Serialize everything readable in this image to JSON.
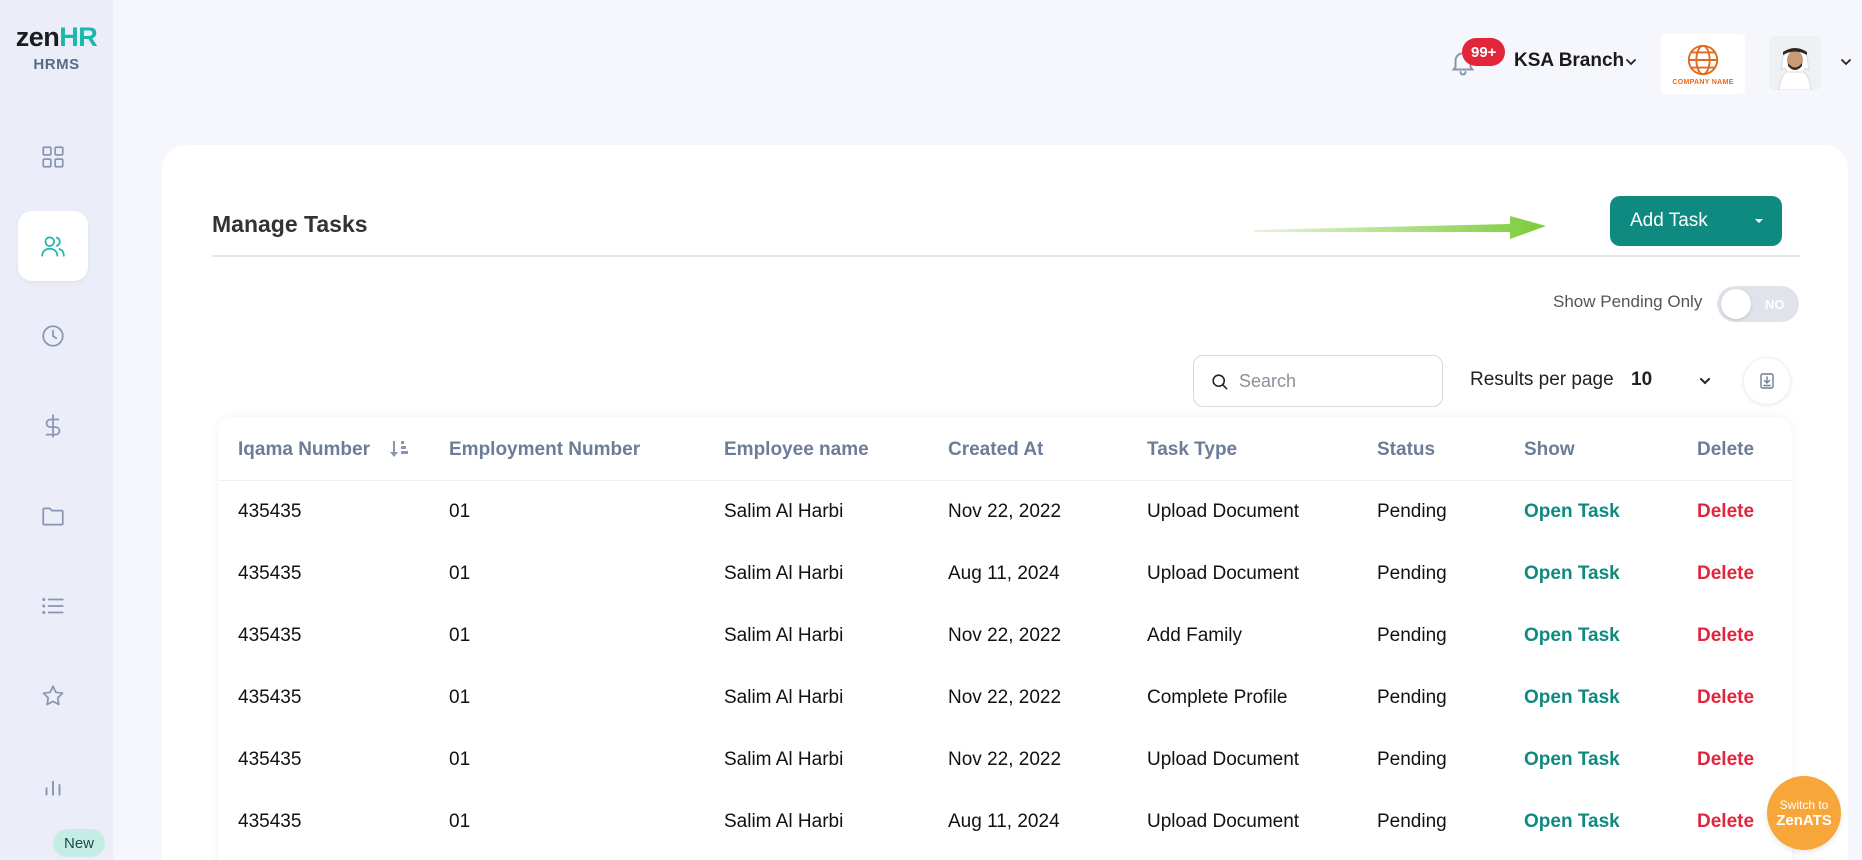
{
  "app": {
    "logo_main": "zen",
    "logo_accent": "HR",
    "logo_sub": "HRMS"
  },
  "sidebar": {
    "items": [
      {
        "name": "dashboard",
        "icon": "grid-icon"
      },
      {
        "name": "employees",
        "icon": "users-icon",
        "active": true
      },
      {
        "name": "attendance",
        "icon": "clock-icon"
      },
      {
        "name": "payroll",
        "icon": "dollar-icon"
      },
      {
        "name": "documents",
        "icon": "folder-icon"
      },
      {
        "name": "lists",
        "icon": "list-icon"
      },
      {
        "name": "performance",
        "icon": "star-icon"
      },
      {
        "name": "reports",
        "icon": "bar-chart-icon"
      }
    ],
    "new_badge": "New"
  },
  "header": {
    "notifications_count": "99+",
    "branch": "KSA Branch",
    "company_name": "COMPANY NAME"
  },
  "page": {
    "title": "Manage Tasks",
    "add_task_label": "Add Task",
    "show_pending_label": "Show Pending Only",
    "show_pending_state": "NO",
    "search_placeholder": "Search",
    "results_per_page_label": "Results per page",
    "results_per_page_value": "10"
  },
  "table": {
    "columns": [
      "Iqama Number",
      "Employment Number",
      "Employee name",
      "Created At",
      "Task Type",
      "Status",
      "Show",
      "Delete"
    ],
    "rows": [
      {
        "iqama": "435435",
        "employment": "01",
        "name": "Salim Al Harbi",
        "created": "Nov 22, 2022",
        "type": "Upload Document",
        "status": "Pending",
        "show": "Open Task",
        "delete": "Delete"
      },
      {
        "iqama": "435435",
        "employment": "01",
        "name": "Salim Al Harbi",
        "created": "Aug 11, 2024",
        "type": "Upload Document",
        "status": "Pending",
        "show": "Open Task",
        "delete": "Delete"
      },
      {
        "iqama": "435435",
        "employment": "01",
        "name": "Salim Al Harbi",
        "created": "Nov 22, 2022",
        "type": "Add Family",
        "status": "Pending",
        "show": "Open Task",
        "delete": "Delete"
      },
      {
        "iqama": "435435",
        "employment": "01",
        "name": "Salim Al Harbi",
        "created": "Nov 22, 2022",
        "type": "Complete Profile",
        "status": "Pending",
        "show": "Open Task",
        "delete": "Delete"
      },
      {
        "iqama": "435435",
        "employment": "01",
        "name": "Salim Al Harbi",
        "created": "Nov 22, 2022",
        "type": "Upload Document",
        "status": "Pending",
        "show": "Open Task",
        "delete": "Delete"
      },
      {
        "iqama": "435435",
        "employment": "01",
        "name": "Salim Al Harbi",
        "created": "Aug 11, 2024",
        "type": "Upload Document",
        "status": "Pending",
        "show": "Open Task",
        "delete": "Delete"
      }
    ]
  },
  "floating": {
    "switch_line1": "Switch to",
    "switch_line2": "ZenATS"
  },
  "colors": {
    "primary": "#0f8a80",
    "danger": "#e0263c",
    "badge": "#e3253a",
    "ats": "#f7a63a",
    "arrow": "#7ccc3a"
  }
}
